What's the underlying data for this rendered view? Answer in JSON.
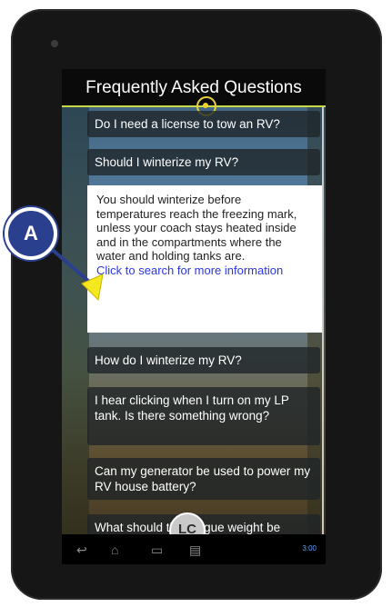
{
  "title": "Frequently Asked Questions",
  "faqs": [
    "Do I need a license to tow an RV?",
    "Should I winterize my RV?",
    "How do I winterize my RV?",
    "I hear clicking when I turn on my LP tank.  Is there something wrong?",
    "Can my generator be used to power my RV house battery?",
    "What should the tongue weight be"
  ],
  "answer": {
    "text": "You should winterize before temperatures reach the freezing mark, unless your coach stays heated inside and in the compartments where the water and holding tanks are.",
    "link": "Click to search for more information"
  },
  "callout": {
    "label": "A",
    "color": "#2b3f8f",
    "arrow_color": "#f6e81e"
  },
  "logo_text": "LC",
  "status_time": "3:00",
  "colors": {
    "accent": "#c7d94a",
    "link": "#2a36e0"
  }
}
